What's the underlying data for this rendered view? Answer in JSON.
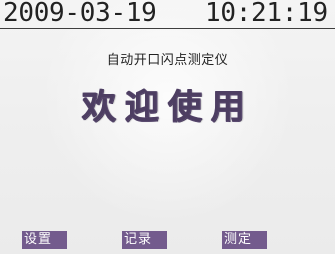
{
  "status_bar": {
    "date": "2009-03-19",
    "time": "10:21:19"
  },
  "main": {
    "device_name": "自动开口闪点测定仪",
    "welcome_text": "欢迎使用"
  },
  "softkeys": [
    {
      "label": "设置"
    },
    {
      "label": "记录"
    },
    {
      "label": "测定"
    }
  ],
  "colors": {
    "background": "#f1f1f1",
    "primary_text": "#222222",
    "welcome": "#4d3e62",
    "softkey_bg": "#735b8d",
    "softkey_text": "#ffffff"
  }
}
